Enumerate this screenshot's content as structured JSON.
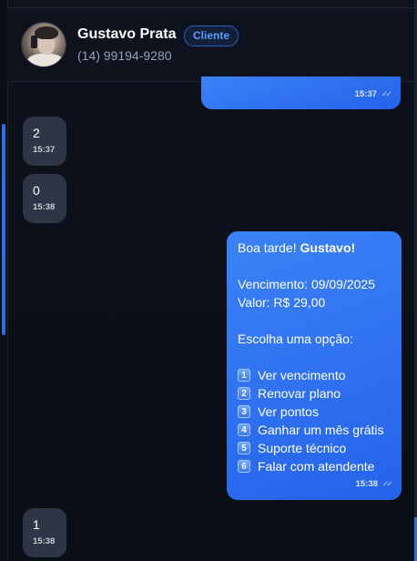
{
  "contact": {
    "name": "Gustavo Prata",
    "badge": "Cliente",
    "phone": "(14) 99194-9280"
  },
  "messages": [
    {
      "direction": "outgoing",
      "time": "15:37"
    },
    {
      "direction": "incoming",
      "text": "2",
      "time": "15:37"
    },
    {
      "direction": "incoming",
      "text": "0",
      "time": "15:38"
    },
    {
      "direction": "outgoing",
      "greeting": "Boa tarde! ",
      "greeting_name": "Gustavo!",
      "due_line": "Vencimento: 09/09/2025",
      "value_line": "Valor: R$ 29,00",
      "prompt": "Escolha uma opção:",
      "options": [
        {
          "key": "1",
          "label": "Ver vencimento"
        },
        {
          "key": "2",
          "label": "Renovar plano"
        },
        {
          "key": "3",
          "label": "Ver pontos"
        },
        {
          "key": "4",
          "label": "Ganhar um mês grátis"
        },
        {
          "key": "5",
          "label": "Suporte técnico"
        },
        {
          "key": "6",
          "label": "Falar com atendente"
        }
      ],
      "time": "15:38"
    },
    {
      "direction": "incoming",
      "text": "1",
      "time": "15:38"
    }
  ],
  "colors": {
    "outgoing_bubble": "#3b82f6",
    "incoming_bubble": "#2e3645",
    "badge_text": "#5b9bff",
    "background": "#0b0f18"
  },
  "icons": {
    "read_receipt": "double-check-icon",
    "avatar": "contact-avatar"
  }
}
